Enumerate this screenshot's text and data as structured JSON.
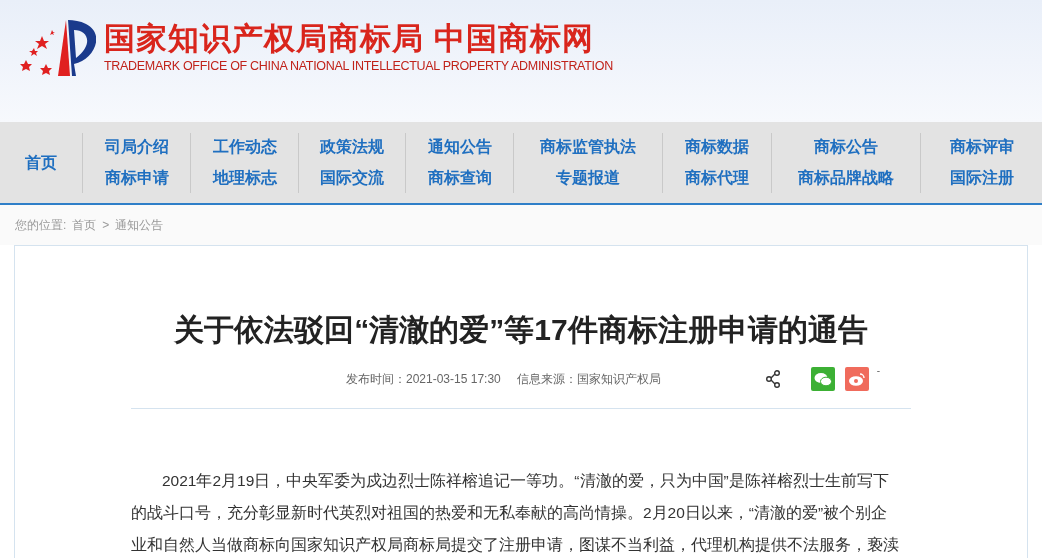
{
  "header": {
    "title": "国家知识产权局商标局 中国商标网",
    "subtitle": "TRADEMARK OFFICE OF CHINA NATIONAL INTELLECTUAL PROPERTY ADMINISTRATION"
  },
  "nav": [
    {
      "items": [
        "首页"
      ]
    },
    {
      "items": [
        "司局介绍",
        "商标申请"
      ]
    },
    {
      "items": [
        "工作动态",
        "地理标志"
      ]
    },
    {
      "items": [
        "政策法规",
        "国际交流"
      ]
    },
    {
      "items": [
        "通知公告",
        "商标查询"
      ]
    },
    {
      "items": [
        "商标监管执法",
        "专题报道"
      ]
    },
    {
      "items": [
        "商标数据",
        "商标代理"
      ]
    },
    {
      "items": [
        "商标公告",
        "商标品牌战略"
      ]
    },
    {
      "items": [
        "商标评审",
        "国际注册"
      ]
    }
  ],
  "breadcrumb": {
    "label": "您的位置:",
    "items": [
      "首页",
      "通知公告"
    ],
    "separator": ">"
  },
  "article": {
    "title": "关于依法驳回“清澈的爱”等17件商标注册申请的通告",
    "published": "发布时间：2021-03-15 17:30",
    "source": "信息来源：国家知识产权局",
    "share_extra": "-",
    "paragraph_lines": [
      "2021年2月19日，中央军委为戍边烈士陈祥榕追记一等功。“清澈的爱，只为中国”是陈祥榕烈士生前写下",
      "的战斗口号，充分彰显新时代英烈对祖国的热爱和无私奉献的高尚情操。2月20日以来，“清澈的爱”被个别企",
      "业和自然人当做商标向国家知识产权局商标局提交了注册申请，图谋不当利益，代理机构提供不法服务，亵渎"
    ]
  }
}
